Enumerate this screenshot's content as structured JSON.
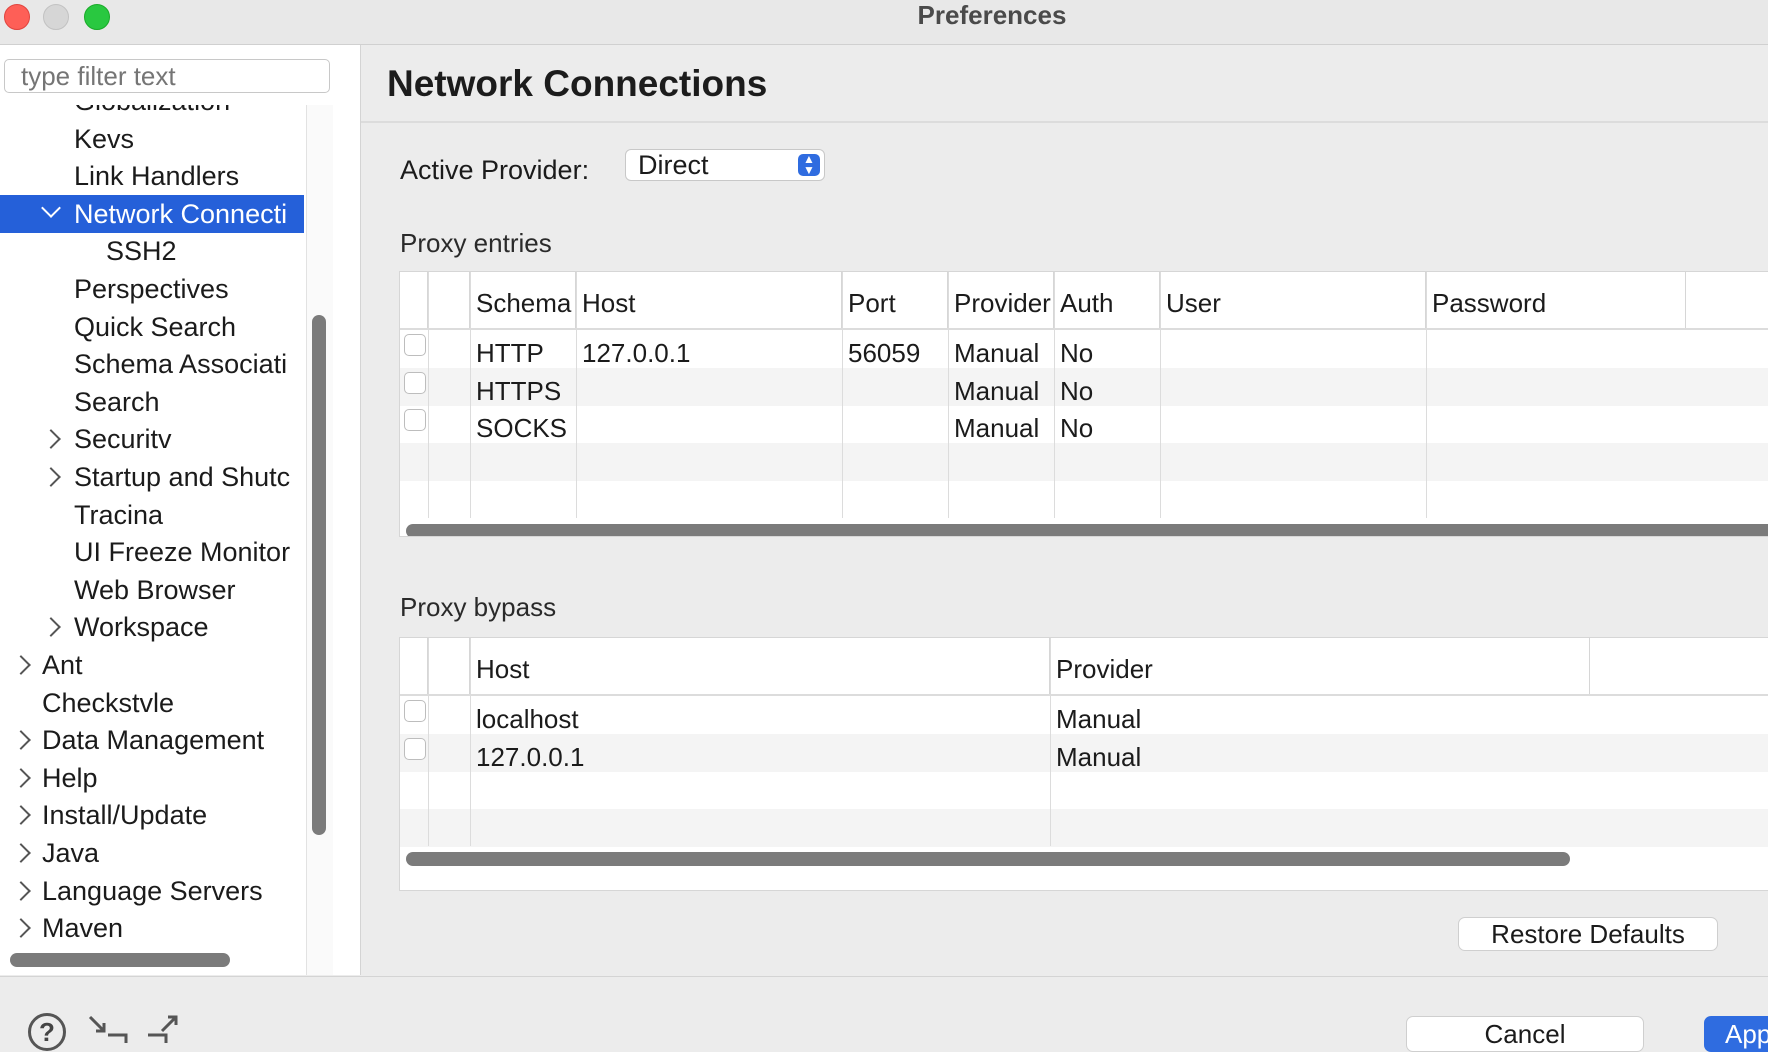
{
  "window": {
    "title": "Preferences"
  },
  "sidebar": {
    "filter_placeholder": "type filter text",
    "items": [
      {
        "label": "Globalization",
        "level": 1,
        "expander": "none"
      },
      {
        "label": "Kevs",
        "level": 1,
        "expander": "none"
      },
      {
        "label": "Link Handlers",
        "level": 1,
        "expander": "none"
      },
      {
        "label": "Network Connecti",
        "level": 1,
        "expander": "expanded",
        "selected": true
      },
      {
        "label": "SSH2",
        "level": 2,
        "expander": "none"
      },
      {
        "label": "Perspectives",
        "level": 1,
        "expander": "none"
      },
      {
        "label": "Quick Search",
        "level": 1,
        "expander": "none"
      },
      {
        "label": "Schema Associati",
        "level": 1,
        "expander": "none"
      },
      {
        "label": "Search",
        "level": 1,
        "expander": "none"
      },
      {
        "label": "Securitv",
        "level": 1,
        "expander": "collapsed"
      },
      {
        "label": "Startup and Shutc",
        "level": 1,
        "expander": "collapsed"
      },
      {
        "label": "Tracina",
        "level": 1,
        "expander": "none"
      },
      {
        "label": "UI Freeze Monitor",
        "level": 1,
        "expander": "none"
      },
      {
        "label": "Web Browser",
        "level": 1,
        "expander": "none"
      },
      {
        "label": "Workspace",
        "level": 1,
        "expander": "collapsed"
      },
      {
        "label": "Ant",
        "level": 0,
        "expander": "collapsed"
      },
      {
        "label": "Checkstvle",
        "level": 0,
        "expander": "none"
      },
      {
        "label": "Data Management",
        "level": 0,
        "expander": "collapsed"
      },
      {
        "label": "Help",
        "level": 0,
        "expander": "collapsed"
      },
      {
        "label": "Install/Update",
        "level": 0,
        "expander": "collapsed"
      },
      {
        "label": "Java",
        "level": 0,
        "expander": "collapsed"
      },
      {
        "label": "Language Servers",
        "level": 0,
        "expander": "collapsed"
      },
      {
        "label": "Maven",
        "level": 0,
        "expander": "collapsed"
      }
    ]
  },
  "main": {
    "title": "Network Connections",
    "active_provider_label": "Active Provider:",
    "active_provider_value": "Direct",
    "proxy_entries": {
      "label": "Proxy entries",
      "columns": [
        "Schema",
        "Host",
        "Port",
        "Provider",
        "Auth",
        "User",
        "Password"
      ],
      "rows": [
        [
          "HTTP",
          "127.0.0.1",
          "56059",
          "Manual",
          "No",
          "",
          ""
        ],
        [
          "HTTPS",
          "",
          "",
          "Manual",
          "No",
          "",
          ""
        ],
        [
          "SOCKS",
          "",
          "",
          "Manual",
          "No",
          "",
          ""
        ]
      ]
    },
    "proxy_bypass": {
      "label": "Proxy bypass",
      "columns": [
        "Host",
        "Provider"
      ],
      "rows": [
        [
          "localhost",
          "Manual"
        ],
        [
          "127.0.0.1",
          "Manual"
        ]
      ]
    },
    "restore_defaults_label": "Restore Defaults"
  },
  "footer": {
    "cancel_label": "Cancel",
    "apply_label": "App",
    "icons": [
      "help-icon",
      "import-icon",
      "export-icon"
    ]
  },
  "colors": {
    "selection": "#2560d9",
    "accent_button": "#2f6ce0"
  }
}
